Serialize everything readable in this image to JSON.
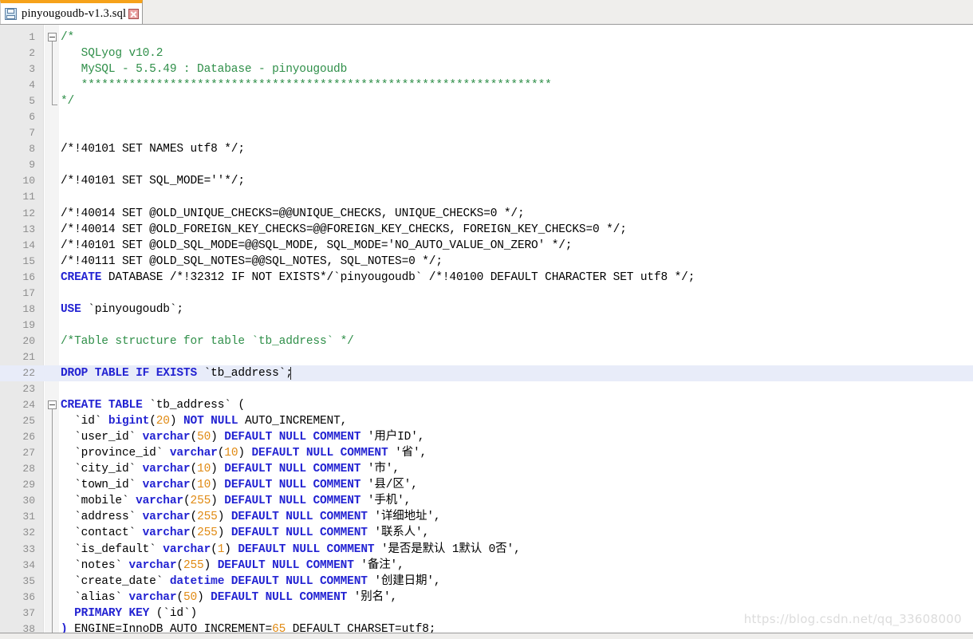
{
  "window": {
    "app": "SQLyog SQL editor"
  },
  "tab": {
    "title": "pinyougoudb-v1.3.sql",
    "save_icon": "floppy-disk-icon",
    "close_icon": "close-icon"
  },
  "watermark": "https://blog.csdn.net/qq_33608000",
  "colors": {
    "keyword": "#2323d2",
    "comment": "#2f8f49",
    "number": "#e08a13",
    "plain": "#000000",
    "current_line": "#e8ecf9",
    "tab_accent": "#f6a21a",
    "gutter": "#e9e9e9"
  },
  "editor": {
    "current_line": 22,
    "cursor_line": 22,
    "cursor_column": 33,
    "first_line": 1,
    "last_line": 38,
    "folds": [
      {
        "start": 1,
        "end": 5
      },
      {
        "start": 24,
        "end": 38
      }
    ],
    "lines": [
      {
        "n": 1,
        "tokens": [
          {
            "t": "/*",
            "c": "cm"
          }
        ]
      },
      {
        "n": 2,
        "tokens": [
          {
            "t": "   SQLyog v10.2",
            "c": "cm"
          }
        ]
      },
      {
        "n": 3,
        "tokens": [
          {
            "t": "   MySQL - 5.5.49 : Database - pinyougoudb",
            "c": "cm"
          }
        ]
      },
      {
        "n": 4,
        "tokens": [
          {
            "t": "   *********************************************************************",
            "c": "cm"
          }
        ]
      },
      {
        "n": 5,
        "tokens": [
          {
            "t": "*/",
            "c": "cm"
          }
        ]
      },
      {
        "n": 6,
        "tokens": []
      },
      {
        "n": 7,
        "tokens": []
      },
      {
        "n": 8,
        "tokens": [
          {
            "t": "/*!40101 SET NAMES utf8 */;",
            "c": "pl"
          }
        ]
      },
      {
        "n": 9,
        "tokens": []
      },
      {
        "n": 10,
        "tokens": [
          {
            "t": "/*!40101 SET SQL_MODE=''*/;",
            "c": "pl"
          }
        ]
      },
      {
        "n": 11,
        "tokens": []
      },
      {
        "n": 12,
        "tokens": [
          {
            "t": "/*!40014 SET @OLD_UNIQUE_CHECKS=@@UNIQUE_CHECKS, UNIQUE_CHECKS=0 */;",
            "c": "pl"
          }
        ]
      },
      {
        "n": 13,
        "tokens": [
          {
            "t": "/*!40014 SET @OLD_FOREIGN_KEY_CHECKS=@@FOREIGN_KEY_CHECKS, FOREIGN_KEY_CHECKS=0 */;",
            "c": "pl"
          }
        ]
      },
      {
        "n": 14,
        "tokens": [
          {
            "t": "/*!40101 SET @OLD_SQL_MODE=@@SQL_MODE, SQL_MODE='NO_AUTO_VALUE_ON_ZERO' */;",
            "c": "pl"
          }
        ]
      },
      {
        "n": 15,
        "tokens": [
          {
            "t": "/*!40111 SET @OLD_SQL_NOTES=@@SQL_NOTES, SQL_NOTES=0 */;",
            "c": "pl"
          }
        ]
      },
      {
        "n": 16,
        "tokens": [
          {
            "t": "CREATE",
            "c": "kw"
          },
          {
            "t": " DATABASE /*!32312 IF NOT EXISTS*/`pinyougoudb` /*!40100 DEFAULT CHARACTER SET utf8 */;",
            "c": "pl"
          }
        ]
      },
      {
        "n": 17,
        "tokens": []
      },
      {
        "n": 18,
        "tokens": [
          {
            "t": "USE",
            "c": "kw"
          },
          {
            "t": " `pinyougoudb`;",
            "c": "pl"
          }
        ]
      },
      {
        "n": 19,
        "tokens": []
      },
      {
        "n": 20,
        "tokens": [
          {
            "t": "/*Table structure for table `tb_address` */",
            "c": "cm"
          }
        ]
      },
      {
        "n": 21,
        "tokens": []
      },
      {
        "n": 22,
        "tokens": [
          {
            "t": "DROP TABLE IF EXISTS",
            "c": "kw"
          },
          {
            "t": " `tb_address`;",
            "c": "pl"
          }
        ]
      },
      {
        "n": 23,
        "tokens": []
      },
      {
        "n": 24,
        "tokens": [
          {
            "t": "CREATE TABLE",
            "c": "kw"
          },
          {
            "t": " `tb_address` (",
            "c": "pl"
          }
        ]
      },
      {
        "n": 25,
        "tokens": [
          {
            "t": "  `id` ",
            "c": "pl"
          },
          {
            "t": "bigint",
            "c": "kw"
          },
          {
            "t": "(",
            "c": "pl"
          },
          {
            "t": "20",
            "c": "num-lit"
          },
          {
            "t": ") ",
            "c": "pl"
          },
          {
            "t": "NOT NULL",
            "c": "kw"
          },
          {
            "t": " AUTO_INCREMENT,",
            "c": "pl"
          }
        ]
      },
      {
        "n": 26,
        "tokens": [
          {
            "t": "  `user_id` ",
            "c": "pl"
          },
          {
            "t": "varchar",
            "c": "kw"
          },
          {
            "t": "(",
            "c": "pl"
          },
          {
            "t": "50",
            "c": "num-lit"
          },
          {
            "t": ") ",
            "c": "pl"
          },
          {
            "t": "DEFAULT NULL COMMENT",
            "c": "kw"
          },
          {
            "t": " '用户ID',",
            "c": "pl"
          }
        ]
      },
      {
        "n": 27,
        "tokens": [
          {
            "t": "  `province_id` ",
            "c": "pl"
          },
          {
            "t": "varchar",
            "c": "kw"
          },
          {
            "t": "(",
            "c": "pl"
          },
          {
            "t": "10",
            "c": "num-lit"
          },
          {
            "t": ") ",
            "c": "pl"
          },
          {
            "t": "DEFAULT NULL COMMENT",
            "c": "kw"
          },
          {
            "t": " '省',",
            "c": "pl"
          }
        ]
      },
      {
        "n": 28,
        "tokens": [
          {
            "t": "  `city_id` ",
            "c": "pl"
          },
          {
            "t": "varchar",
            "c": "kw"
          },
          {
            "t": "(",
            "c": "pl"
          },
          {
            "t": "10",
            "c": "num-lit"
          },
          {
            "t": ") ",
            "c": "pl"
          },
          {
            "t": "DEFAULT NULL COMMENT",
            "c": "kw"
          },
          {
            "t": " '市',",
            "c": "pl"
          }
        ]
      },
      {
        "n": 29,
        "tokens": [
          {
            "t": "  `town_id` ",
            "c": "pl"
          },
          {
            "t": "varchar",
            "c": "kw"
          },
          {
            "t": "(",
            "c": "pl"
          },
          {
            "t": "10",
            "c": "num-lit"
          },
          {
            "t": ") ",
            "c": "pl"
          },
          {
            "t": "DEFAULT NULL COMMENT",
            "c": "kw"
          },
          {
            "t": " '县/区',",
            "c": "pl"
          }
        ]
      },
      {
        "n": 30,
        "tokens": [
          {
            "t": "  `mobile` ",
            "c": "pl"
          },
          {
            "t": "varchar",
            "c": "kw"
          },
          {
            "t": "(",
            "c": "pl"
          },
          {
            "t": "255",
            "c": "num-lit"
          },
          {
            "t": ") ",
            "c": "pl"
          },
          {
            "t": "DEFAULT NULL COMMENT",
            "c": "kw"
          },
          {
            "t": " '手机',",
            "c": "pl"
          }
        ]
      },
      {
        "n": 31,
        "tokens": [
          {
            "t": "  `address` ",
            "c": "pl"
          },
          {
            "t": "varchar",
            "c": "kw"
          },
          {
            "t": "(",
            "c": "pl"
          },
          {
            "t": "255",
            "c": "num-lit"
          },
          {
            "t": ") ",
            "c": "pl"
          },
          {
            "t": "DEFAULT NULL COMMENT",
            "c": "kw"
          },
          {
            "t": " '详细地址',",
            "c": "pl"
          }
        ]
      },
      {
        "n": 32,
        "tokens": [
          {
            "t": "  `contact` ",
            "c": "pl"
          },
          {
            "t": "varchar",
            "c": "kw"
          },
          {
            "t": "(",
            "c": "pl"
          },
          {
            "t": "255",
            "c": "num-lit"
          },
          {
            "t": ") ",
            "c": "pl"
          },
          {
            "t": "DEFAULT NULL COMMENT",
            "c": "kw"
          },
          {
            "t": " '联系人',",
            "c": "pl"
          }
        ]
      },
      {
        "n": 33,
        "tokens": [
          {
            "t": "  `is_default` ",
            "c": "pl"
          },
          {
            "t": "varchar",
            "c": "kw"
          },
          {
            "t": "(",
            "c": "pl"
          },
          {
            "t": "1",
            "c": "num-lit"
          },
          {
            "t": ") ",
            "c": "pl"
          },
          {
            "t": "DEFAULT NULL COMMENT",
            "c": "kw"
          },
          {
            "t": " '是否是默认 1默认 0否',",
            "c": "pl"
          }
        ]
      },
      {
        "n": 34,
        "tokens": [
          {
            "t": "  `notes` ",
            "c": "pl"
          },
          {
            "t": "varchar",
            "c": "kw"
          },
          {
            "t": "(",
            "c": "pl"
          },
          {
            "t": "255",
            "c": "num-lit"
          },
          {
            "t": ") ",
            "c": "pl"
          },
          {
            "t": "DEFAULT NULL COMMENT",
            "c": "kw"
          },
          {
            "t": " '备注',",
            "c": "pl"
          }
        ]
      },
      {
        "n": 35,
        "tokens": [
          {
            "t": "  `create_date` ",
            "c": "pl"
          },
          {
            "t": "datetime DEFAULT NULL COMMENT",
            "c": "kw"
          },
          {
            "t": " '创建日期',",
            "c": "pl"
          }
        ]
      },
      {
        "n": 36,
        "tokens": [
          {
            "t": "  `alias` ",
            "c": "pl"
          },
          {
            "t": "varchar",
            "c": "kw"
          },
          {
            "t": "(",
            "c": "pl"
          },
          {
            "t": "50",
            "c": "num-lit"
          },
          {
            "t": ") ",
            "c": "pl"
          },
          {
            "t": "DEFAULT NULL COMMENT",
            "c": "kw"
          },
          {
            "t": " '别名',",
            "c": "pl"
          }
        ]
      },
      {
        "n": 37,
        "tokens": [
          {
            "t": "  ",
            "c": "pl"
          },
          {
            "t": "PRIMARY KEY",
            "c": "kw"
          },
          {
            "t": " (`id`)",
            "c": "pl"
          }
        ]
      },
      {
        "n": 38,
        "tokens": [
          {
            "t": ") ",
            "c": "kw"
          },
          {
            "t": "ENGINE=InnoDB AUTO_INCREMENT=",
            "c": "pl"
          },
          {
            "t": "65",
            "c": "num-lit"
          },
          {
            "t": " DEFAULT CHARSET=utf8;",
            "c": "pl"
          }
        ]
      }
    ]
  }
}
